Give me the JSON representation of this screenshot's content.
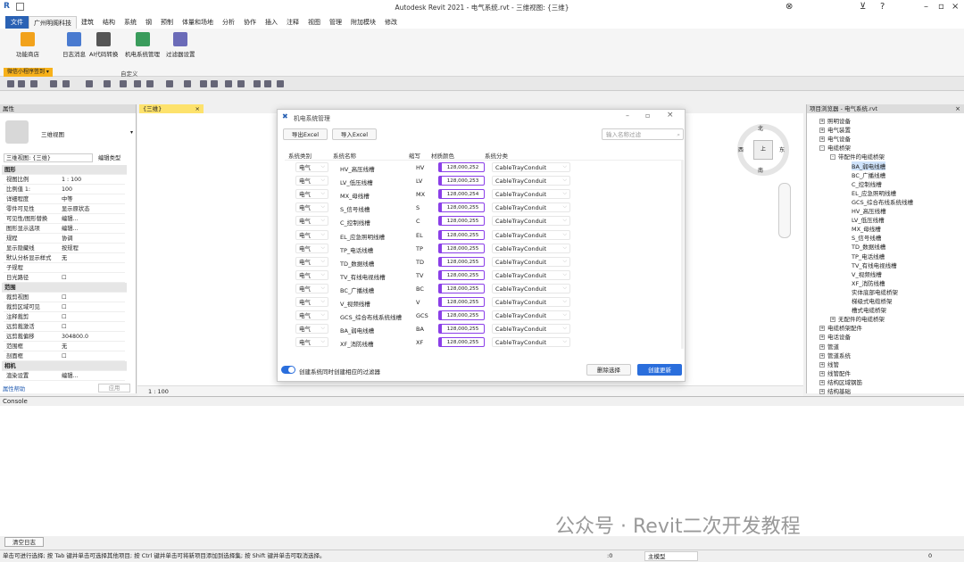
{
  "window": {
    "title": "Autodesk Revit 2021 - 电气系统.rvt - 三维视图: {三维}"
  },
  "tabs": [
    "文件",
    "广州明阁科技",
    "建筑",
    "结构",
    "系统",
    "钢",
    "预制",
    "体量和场地",
    "分析",
    "协作",
    "插入",
    "注释",
    "视图",
    "管理",
    "附加模块",
    "修改"
  ],
  "ribbon": {
    "buttons": [
      {
        "label": "功能商店",
        "icon": "store-icon"
      },
      {
        "label": "日志消息",
        "icon": "log-icon"
      },
      {
        "label": "AI代码转换",
        "icon": "code-icon"
      },
      {
        "label": "机电系统管理",
        "icon": "mep-system-icon"
      },
      {
        "label": "过滤器设置",
        "icon": "filter-icon"
      }
    ],
    "dropdown": "微信小程序签到 ▾",
    "group_label": "自定义"
  },
  "view_tab": "{三维}",
  "properties": {
    "header": "属性",
    "family": "三维视图",
    "selector": "三维视图: {三维}",
    "edit_type": "编辑类型",
    "rows": [
      {
        "k": "图形",
        "v": "",
        "sec": true
      },
      {
        "k": "视图比例",
        "v": "1 : 100"
      },
      {
        "k": "比例值 1:",
        "v": "100"
      },
      {
        "k": "详细程度",
        "v": "中等"
      },
      {
        "k": "零件可见性",
        "v": "显示原状态"
      },
      {
        "k": "可见性/图形替换",
        "v": "编辑..."
      },
      {
        "k": "图形显示选项",
        "v": "编辑..."
      },
      {
        "k": "规程",
        "v": "协调"
      },
      {
        "k": "显示隐藏线",
        "v": "按规程"
      },
      {
        "k": "默认分析显示样式",
        "v": "无"
      },
      {
        "k": "子规程",
        "v": ""
      },
      {
        "k": "日光路径",
        "v": "☐"
      },
      {
        "k": "范围",
        "v": "",
        "sec": true
      },
      {
        "k": "裁剪视图",
        "v": "☐"
      },
      {
        "k": "裁剪区域可见",
        "v": "☐"
      },
      {
        "k": "注释裁剪",
        "v": "☐"
      },
      {
        "k": "远剪裁激活",
        "v": "☐"
      },
      {
        "k": "远剪裁偏移",
        "v": "304800.0"
      },
      {
        "k": "范围框",
        "v": "无"
      },
      {
        "k": "剖面框",
        "v": "☐"
      },
      {
        "k": "相机",
        "v": "",
        "sec": true
      },
      {
        "k": "渲染设置",
        "v": "编辑..."
      }
    ],
    "help": "属性帮助",
    "apply": "应用"
  },
  "viewbar": {
    "scale": "1 : 100"
  },
  "viewcube": {
    "n": "北",
    "s": "南",
    "w": "西",
    "e": "东",
    "face": "上"
  },
  "browser": {
    "title": "项目浏览器 - 电气系统.rvt",
    "items": [
      {
        "t": "照明设备",
        "d": 1,
        "tg": "+"
      },
      {
        "t": "电气装置",
        "d": 1,
        "tg": "+"
      },
      {
        "t": "电气设备",
        "d": 1,
        "tg": "+"
      },
      {
        "t": "电缆桥架",
        "d": 1,
        "tg": "-"
      },
      {
        "t": "带配件的电缆桥架",
        "d": 2,
        "tg": "-"
      },
      {
        "t": "BA_弱电线槽",
        "d": 3,
        "sel": true
      },
      {
        "t": "BC_广播线槽",
        "d": 3
      },
      {
        "t": "C_控制线槽",
        "d": 3
      },
      {
        "t": "EL_应急照明线槽",
        "d": 3
      },
      {
        "t": "GCS_综合布线系统线槽",
        "d": 3
      },
      {
        "t": "HV_高压线槽",
        "d": 3
      },
      {
        "t": "LV_低压线槽",
        "d": 3
      },
      {
        "t": "MX_母线槽",
        "d": 3
      },
      {
        "t": "S_信号线槽",
        "d": 3
      },
      {
        "t": "TD_数据线槽",
        "d": 3
      },
      {
        "t": "TP_电话线槽",
        "d": 3
      },
      {
        "t": "TV_有线电视线槽",
        "d": 3
      },
      {
        "t": "V_视频线槽",
        "d": 3
      },
      {
        "t": "XF_消防线槽",
        "d": 3
      },
      {
        "t": "实体底部电缆桥架",
        "d": 3
      },
      {
        "t": "梯级式电缆桥架",
        "d": 3
      },
      {
        "t": "槽式电缆桥架",
        "d": 3
      },
      {
        "t": "无配件的电缆桥架",
        "d": 2,
        "tg": "+"
      },
      {
        "t": "电缆桥架配件",
        "d": 1,
        "tg": "+"
      },
      {
        "t": "电话设备",
        "d": 1,
        "tg": "+"
      },
      {
        "t": "管道",
        "d": 1,
        "tg": "+"
      },
      {
        "t": "管道系统",
        "d": 1,
        "tg": "+"
      },
      {
        "t": "线管",
        "d": 1,
        "tg": "+"
      },
      {
        "t": "线管配件",
        "d": 1,
        "tg": "+"
      },
      {
        "t": "结构区域钢筋",
        "d": 1,
        "tg": "+"
      },
      {
        "t": "结构基础",
        "d": 1,
        "tg": "+"
      }
    ]
  },
  "console": {
    "title": "Console",
    "clear": "清空日志"
  },
  "status": {
    "text": "单击可进行选择; 按 Tab 键并单击可选择其他项目; 按 Ctrl 键并单击可将新项目添加到选择集; 按 Shift 键并单击可取消选择。",
    "zero": ":0",
    "model": "主模型",
    "filter": "0"
  },
  "watermark": "公众号 · Revit二次开发教程",
  "dialog": {
    "title": "机电系统管理",
    "export": "导出Excel",
    "import": "导入Excel",
    "search_placeholder": "输入名称过滤",
    "columns": [
      "系统类别",
      "系统名称",
      "缩写",
      "材质颜色",
      "系统分类"
    ],
    "rows": [
      {
        "type": "电气",
        "name": "HV_高压线槽",
        "abbr": "HV",
        "color": "128,000,252",
        "cls": "CableTrayConduit"
      },
      {
        "type": "电气",
        "name": "LV_低压线槽",
        "abbr": "LV",
        "color": "128,000,253",
        "cls": "CableTrayConduit"
      },
      {
        "type": "电气",
        "name": "MX_母线槽",
        "abbr": "MX",
        "color": "128,000,254",
        "cls": "CableTrayConduit"
      },
      {
        "type": "电气",
        "name": "S_信号线槽",
        "abbr": "S",
        "color": "128,000,255",
        "cls": "CableTrayConduit"
      },
      {
        "type": "电气",
        "name": "C_控制线槽",
        "abbr": "C",
        "color": "128,000,255",
        "cls": "CableTrayConduit"
      },
      {
        "type": "电气",
        "name": "EL_应急照明线槽",
        "abbr": "EL",
        "color": "128,000,255",
        "cls": "CableTrayConduit"
      },
      {
        "type": "电气",
        "name": "TP_电话线槽",
        "abbr": "TP",
        "color": "128,000,255",
        "cls": "CableTrayConduit"
      },
      {
        "type": "电气",
        "name": "TD_数据线槽",
        "abbr": "TD",
        "color": "128,000,255",
        "cls": "CableTrayConduit"
      },
      {
        "type": "电气",
        "name": "TV_有线电视线槽",
        "abbr": "TV",
        "color": "128,000,255",
        "cls": "CableTrayConduit"
      },
      {
        "type": "电气",
        "name": "BC_广播线槽",
        "abbr": "BC",
        "color": "128,000,255",
        "cls": "CableTrayConduit"
      },
      {
        "type": "电气",
        "name": "V_视频线槽",
        "abbr": "V",
        "color": "128,000,255",
        "cls": "CableTrayConduit"
      },
      {
        "type": "电气",
        "name": "GCS_综合布线系统线槽",
        "abbr": "GCS",
        "color": "128,000,255",
        "cls": "CableTrayConduit"
      },
      {
        "type": "电气",
        "name": "BA_弱电线槽",
        "abbr": "BA",
        "color": "128,000,255",
        "cls": "CableTrayConduit"
      },
      {
        "type": "电气",
        "name": "XF_消防线槽",
        "abbr": "XF",
        "color": "128,000,255",
        "cls": "CableTrayConduit"
      }
    ],
    "toggle_label": "创建系统同时创建相应的过滤器",
    "delete": "删除选择",
    "create": "创建更新",
    "accent": "#2a6edc"
  }
}
